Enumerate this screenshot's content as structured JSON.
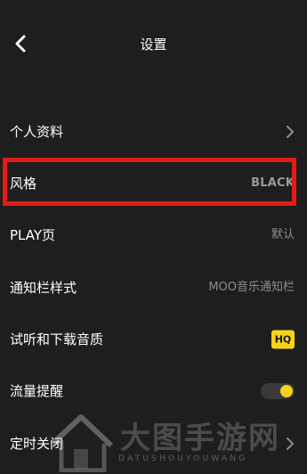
{
  "header": {
    "title": "设置",
    "back_icon": "chevron-left-icon"
  },
  "rows": [
    {
      "label": "个人资料",
      "value": "",
      "trailing": "chevron-right-icon"
    },
    {
      "label": "风格",
      "value": "BLACK"
    },
    {
      "label": "PLAY页",
      "value": "默认"
    },
    {
      "label": "通知栏样式",
      "value": "MOO音乐通知栏"
    },
    {
      "label": "试听和下载音质",
      "badge": "HQ"
    },
    {
      "label": "流量提醒",
      "toggle_on": true
    },
    {
      "label": "定时关闭",
      "trailing": "chevron-right-icon"
    }
  ],
  "highlight_color": "#e31b17",
  "accent_color": "#f6d21c",
  "watermark": {
    "title": "大图手游网",
    "subtitle": "DATUSHOUYOUWANG"
  }
}
